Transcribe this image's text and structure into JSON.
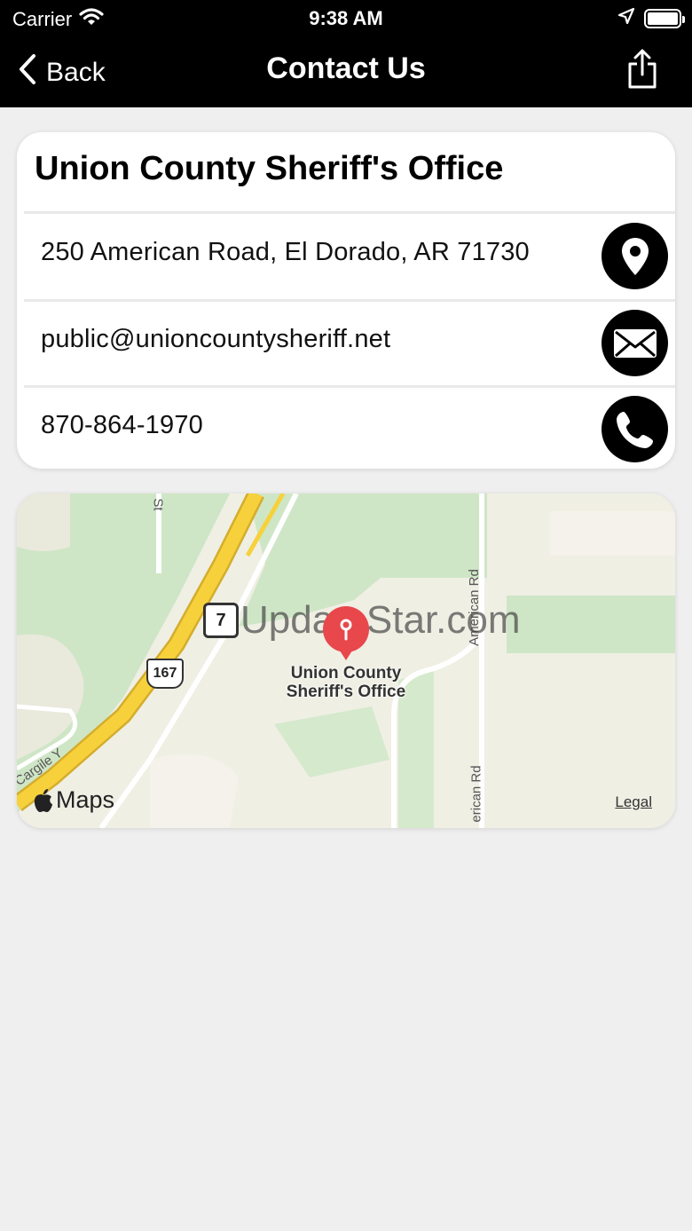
{
  "status_bar": {
    "carrier": "Carrier",
    "time": "9:38 AM"
  },
  "nav": {
    "back_label": "Back",
    "title": "Contact Us"
  },
  "contact": {
    "title": "Union County Sheriff's Office",
    "address": "250 American Road, El Dorado, AR 71730",
    "email": "public@unioncountysheriff.net",
    "phone": "870-864-1970"
  },
  "map": {
    "place_label_line1": "Union County",
    "place_label_line2": "Sheriff's Office",
    "road_american_1": "American Rd",
    "road_american_2": "erican Rd",
    "road_st": "St",
    "road_cargile": "Cargile Y",
    "route_7": "7",
    "route_167": "167",
    "maps_brand": "Maps",
    "legal": "Legal",
    "watermark": "UpdateStar.com"
  },
  "colors": {
    "header_bg": "#000000",
    "page_bg": "#efefef",
    "pin": "#e8474b",
    "highway": "#f7d13c"
  }
}
